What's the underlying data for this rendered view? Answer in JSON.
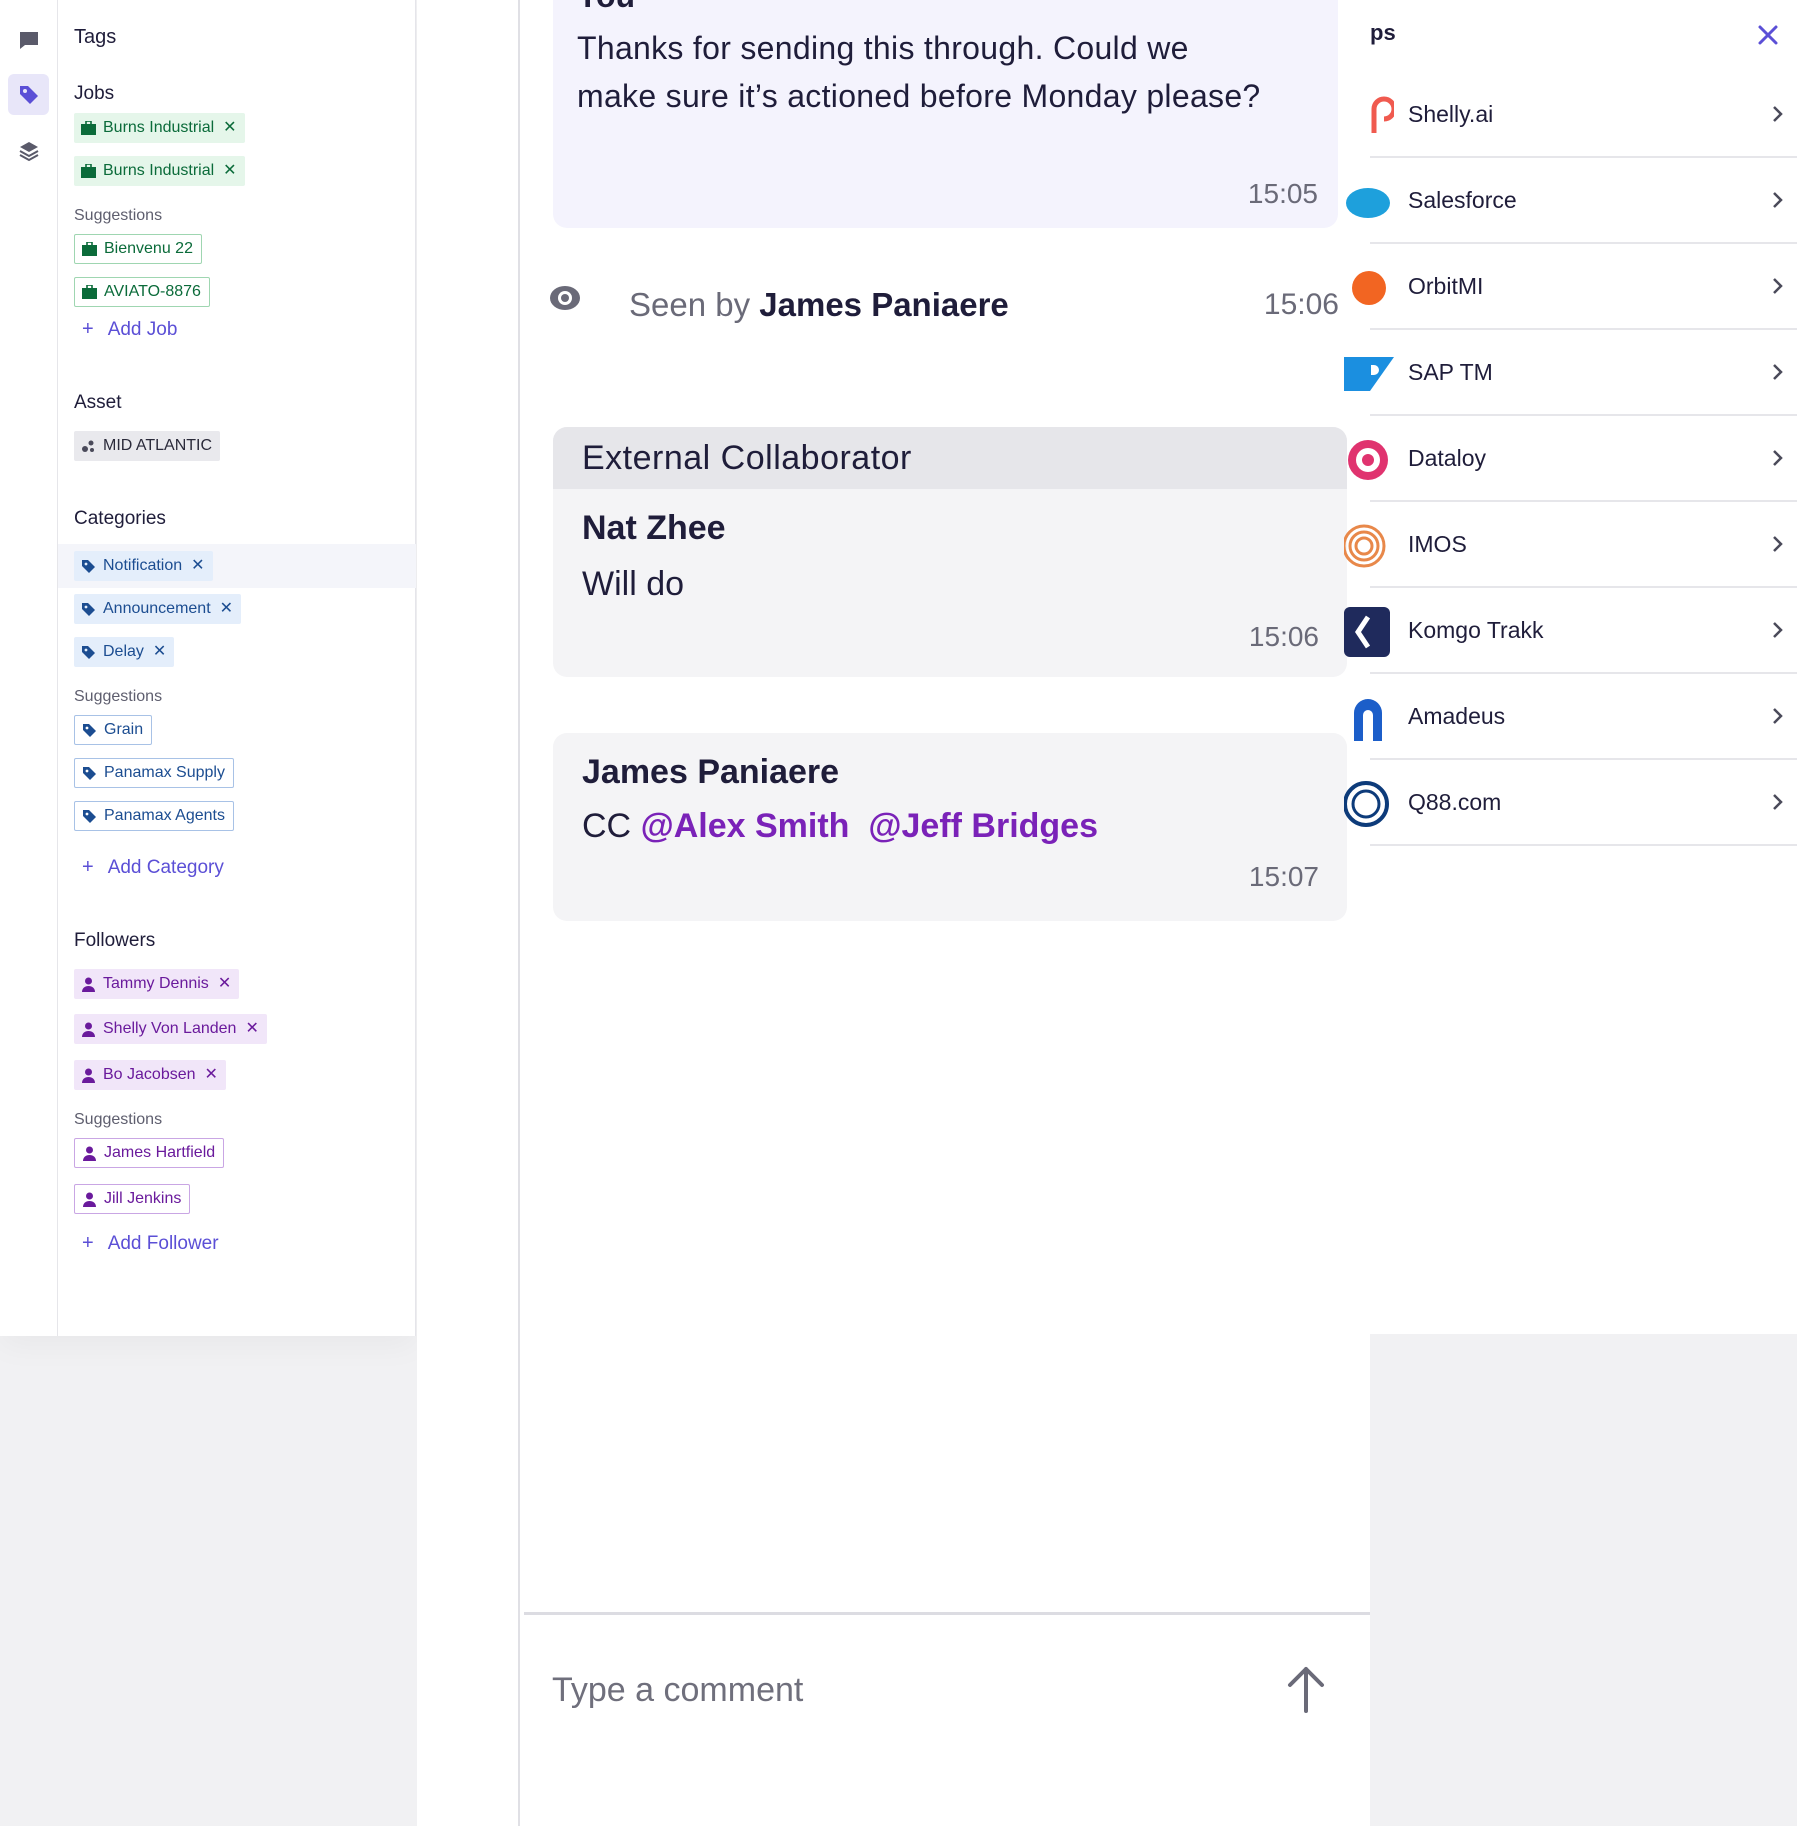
{
  "tags_panel": {
    "title": "Tags",
    "jobs": {
      "title": "Jobs",
      "items": [
        "Burns Industrial",
        "Burns Industrial"
      ],
      "suggestions_label": "Suggestions",
      "suggestions": [
        "Bienvenu 22",
        "AVIATO-8876"
      ],
      "add_label": "Add Job"
    },
    "asset": {
      "title": "Asset",
      "items": [
        "MID ATLANTIC"
      ]
    },
    "categories": {
      "title": "Categories",
      "items": [
        "Notification",
        "Announcement",
        "Delay"
      ],
      "suggestions_label": "Suggestions",
      "suggestions": [
        "Grain",
        "Panamax Supply",
        "Panamax Agents"
      ],
      "add_label": "Add Category"
    },
    "followers": {
      "title": "Followers",
      "items": [
        "Tammy Dennis",
        "Shelly Von Landen",
        "Bo Jacobsen"
      ],
      "suggestions_label": "Suggestions",
      "suggestions": [
        "James Hartfield",
        "Jill Jenkins"
      ],
      "add_label": "Add Follower"
    },
    "remove_glyph": "✕",
    "add_glyph": "+"
  },
  "chat": {
    "messages": [
      {
        "author_partial": "You",
        "text": "Thanks for sending this through. Could we make sure it’s actioned before Monday please?",
        "time": "15:05"
      }
    ],
    "seen": {
      "prefix": "Seen by",
      "name": "James Paniaere",
      "time": "15:06"
    },
    "external_card": {
      "header": "External Collaborator",
      "author": "Nat Zhee",
      "text": "Will do",
      "time": "15:06"
    },
    "cc_card": {
      "author": "James Paniaere",
      "prefix": "CC",
      "mentions": [
        "@Alex Smith",
        "@Jeff Bridges"
      ],
      "time": "15:07"
    },
    "composer": {
      "placeholder": "Type a comment"
    }
  },
  "apps_panel": {
    "title_partial": "ps",
    "apps": [
      {
        "name": "Shelly.ai",
        "icon": "shelly-logo-icon",
        "color": "#f05a4f"
      },
      {
        "name": "Salesforce",
        "icon": "salesforce-logo-icon",
        "color": "#1ea0dc"
      },
      {
        "name": "OrbitMI",
        "icon": "orbitmi-logo-icon",
        "color": "#f26522"
      },
      {
        "name": "SAP TM",
        "icon": "sap-logo-icon",
        "color": "#1b8fe0"
      },
      {
        "name": "Dataloy",
        "icon": "dataloy-logo-icon",
        "color": "#e0336f"
      },
      {
        "name": "IMOS",
        "icon": "imos-logo-icon",
        "color": "#e8884a"
      },
      {
        "name": "Komgo Trakk",
        "icon": "komgo-logo-icon",
        "color": "#1f2a5c"
      },
      {
        "name": "Amadeus",
        "icon": "amadeus-logo-icon",
        "color": "#1c5ec9"
      },
      {
        "name": "Q88.com",
        "icon": "q88-logo-icon",
        "color": "#0d3b7a"
      }
    ]
  },
  "colors": {
    "accent": "#5b4fd6",
    "mention": "#7a22b8",
    "job_chip_bg": "#e5f6ea",
    "category_chip_bg": "#e4eefb",
    "follower_chip_bg": "#f1e6f9"
  }
}
